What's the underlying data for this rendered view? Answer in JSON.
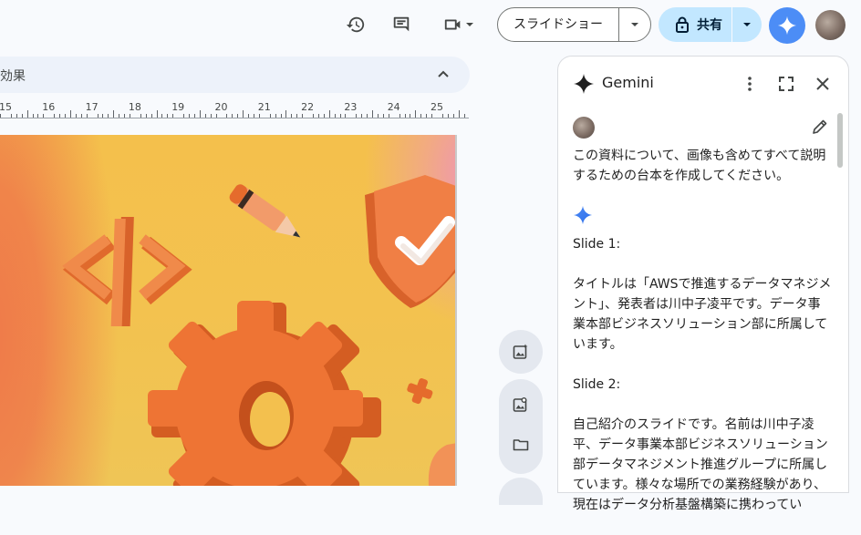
{
  "toolbar": {
    "history_icon": "history-icon",
    "comment_icon": "comment-icon",
    "meet_icon": "video-camera-icon",
    "slideshow_label": "スライドショー",
    "share_label": "共有",
    "gemini_icon": "gemini-spark-icon"
  },
  "menu_strip": {
    "text": "効果"
  },
  "ruler": {
    "labels": [
      "15",
      "16",
      "17",
      "18",
      "19",
      "20",
      "21",
      "22",
      "23",
      "24",
      "25"
    ]
  },
  "gemini": {
    "title": "Gemini",
    "prompt": "この資料について、画像も含めてすべて説明するための台本を作成してください。",
    "reply": [
      "Slide 1:",
      "タイトルは「AWSで推進するデータマネジメント」、発表者は川中子凌平です。データ事業本部ビジネスソリューション部に所属しています。",
      "Slide 2:",
      "自己紹介のスライドです。名前は川中子凌平、データ事業本部ビジネスソリューション部データマネジメント推進グループに所属しています。様々な場所での業務経験があり、現在はデータ分析基盤構築に携わってい"
    ]
  },
  "colors": {
    "accent_blue": "#4c8df6",
    "share_bg": "#c2e7ff",
    "slide_bg": "#f4c04c",
    "slide_orange": "#ef7a4a"
  }
}
